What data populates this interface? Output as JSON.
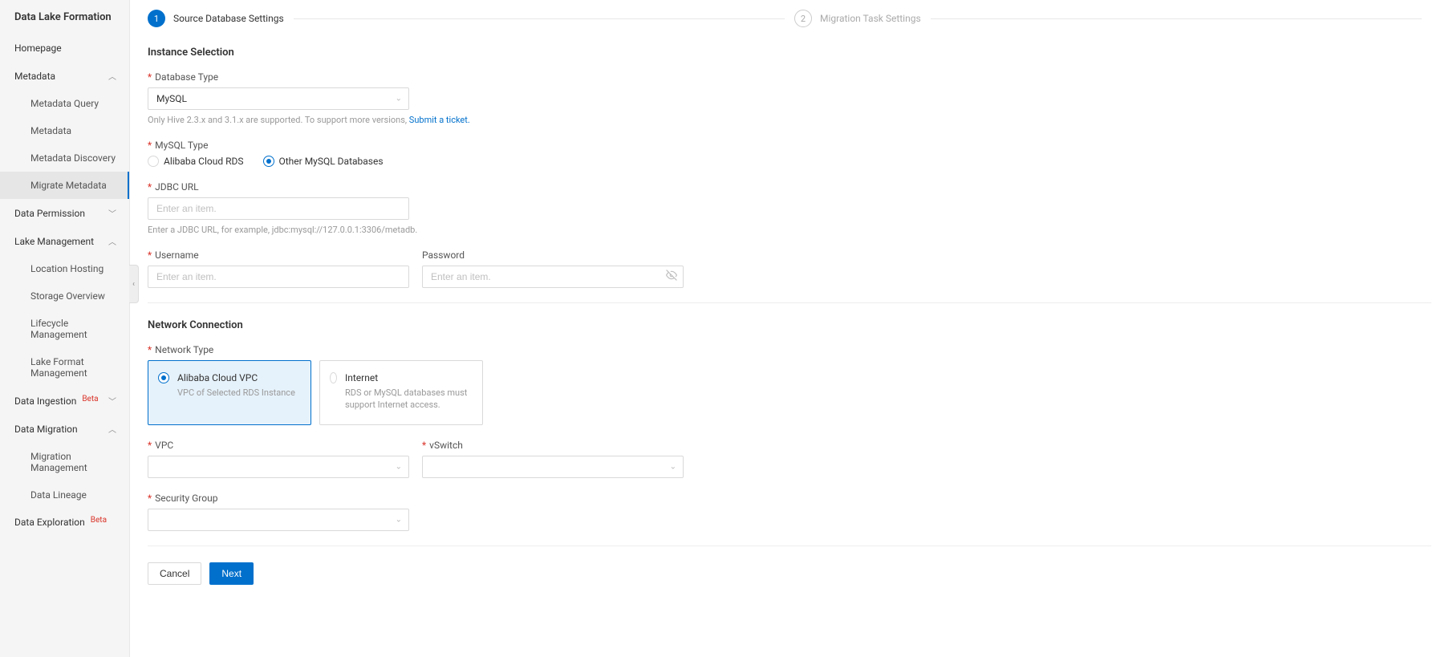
{
  "sidebar": {
    "title": "Data Lake Formation",
    "items": [
      {
        "label": "Homepage",
        "type": "link"
      },
      {
        "label": "Metadata",
        "type": "group",
        "expanded": true
      },
      {
        "label": "Metadata Query",
        "type": "child"
      },
      {
        "label": "Metadata",
        "type": "child"
      },
      {
        "label": "Metadata Discovery",
        "type": "child"
      },
      {
        "label": "Migrate Metadata",
        "type": "child",
        "active": true
      },
      {
        "label": "Data Permission",
        "type": "group",
        "expanded": false
      },
      {
        "label": "Lake Management",
        "type": "group",
        "expanded": true
      },
      {
        "label": "Location Hosting",
        "type": "child"
      },
      {
        "label": "Storage Overview",
        "type": "child"
      },
      {
        "label": "Lifecycle Management",
        "type": "child"
      },
      {
        "label": "Lake Format Management",
        "type": "child"
      },
      {
        "label": "Data Ingestion",
        "type": "group",
        "badge": "Beta",
        "expanded": false
      },
      {
        "label": "Data Migration",
        "type": "group",
        "expanded": true
      },
      {
        "label": "Migration Management",
        "type": "child"
      },
      {
        "label": "Data Lineage",
        "type": "child"
      },
      {
        "label": "Data Exploration",
        "type": "group",
        "badge": "Beta"
      }
    ]
  },
  "steps": {
    "step1": {
      "num": "1",
      "label": "Source Database Settings"
    },
    "step2": {
      "num": "2",
      "label": "Migration Task Settings"
    }
  },
  "instance": {
    "section_title": "Instance Selection",
    "db_type_label": "Database Type",
    "db_type_value": "MySQL",
    "db_type_help_prefix": "Only Hive 2.3.x and 3.1.x are supported. To support more versions,",
    "db_type_help_link": "Submit a ticket.",
    "mysql_type_label": "MySQL Type",
    "mysql_opt_rds": "Alibaba Cloud RDS",
    "mysql_opt_other": "Other MySQL Databases",
    "jdbc_label": "JDBC URL",
    "jdbc_placeholder": "Enter an item.",
    "jdbc_help": "Enter a JDBC URL, for example, jdbc:mysql://127.0.0.1:3306/metadb.",
    "username_label": "Username",
    "username_placeholder": "Enter an item.",
    "password_label": "Password",
    "password_placeholder": "Enter an item."
  },
  "network": {
    "section_title": "Network Connection",
    "network_type_label": "Network Type",
    "opt_vpc_title": "Alibaba Cloud VPC",
    "opt_vpc_desc": "VPC of Selected RDS Instance",
    "opt_internet_title": "Internet",
    "opt_internet_desc": "RDS or MySQL databases must support Internet access.",
    "vpc_label": "VPC",
    "vswitch_label": "vSwitch",
    "sg_label": "Security Group"
  },
  "footer": {
    "cancel": "Cancel",
    "next": "Next"
  }
}
